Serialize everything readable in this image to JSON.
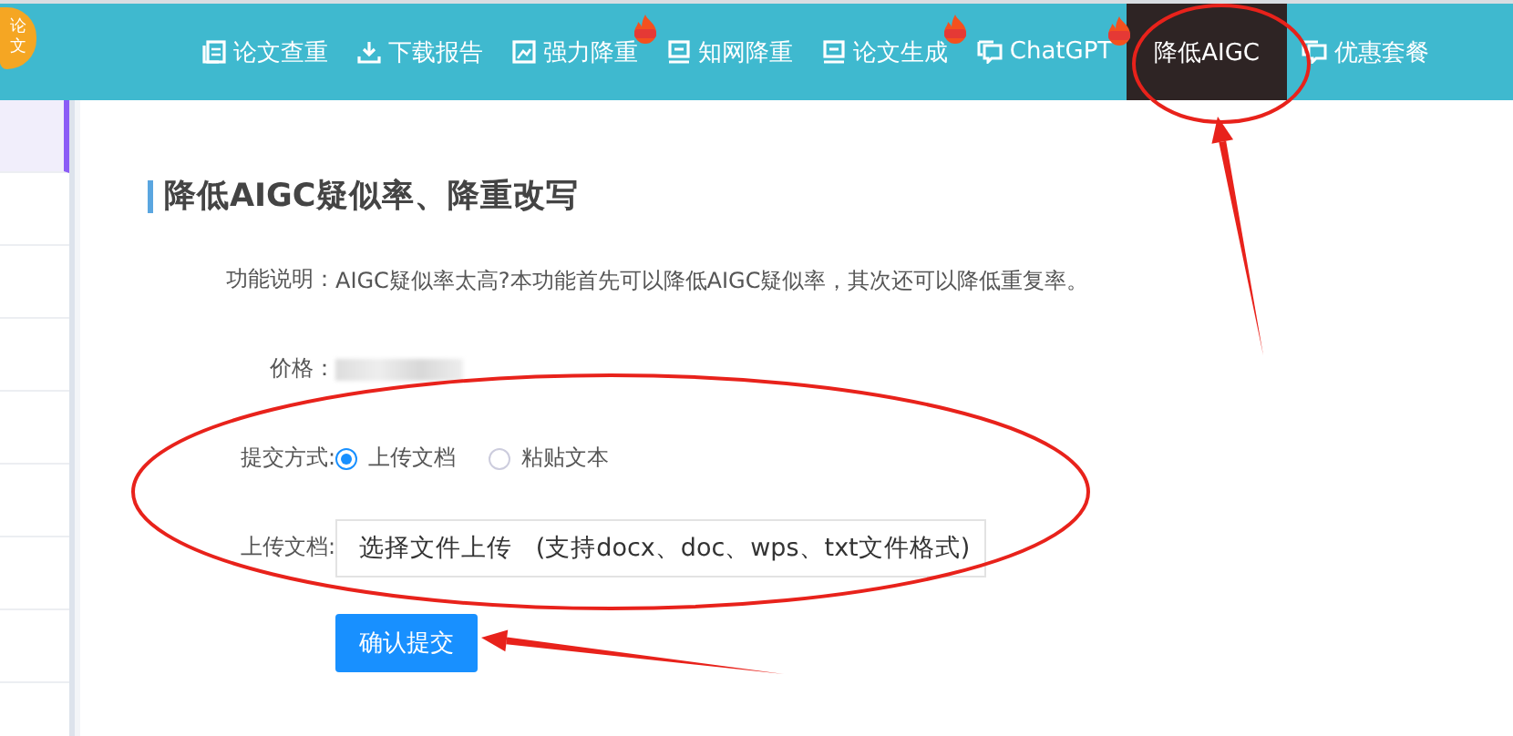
{
  "logo": {
    "text": "论文"
  },
  "nav": {
    "items": [
      {
        "label": "论文查重",
        "hot": false,
        "selected": false
      },
      {
        "label": "下载报告",
        "hot": false,
        "selected": false
      },
      {
        "label": "强力降重",
        "hot": true,
        "selected": false
      },
      {
        "label": "知网降重",
        "hot": false,
        "selected": false
      },
      {
        "label": "论文生成",
        "hot": true,
        "selected": false
      },
      {
        "label": "ChatGPT",
        "hot": true,
        "selected": false
      },
      {
        "label": "降低AIGC",
        "hot": false,
        "selected": true
      },
      {
        "label": "优惠套餐",
        "hot": false,
        "selected": false
      }
    ]
  },
  "sidebar": {
    "items": [
      {
        "selected": true
      },
      {
        "selected": false
      },
      {
        "selected": false
      },
      {
        "selected": false
      },
      {
        "selected": false
      },
      {
        "selected": false
      },
      {
        "selected": false
      },
      {
        "selected": false
      }
    ]
  },
  "page": {
    "title": "降低AIGC疑似率、降重改写",
    "description_label": "功能说明：",
    "description": "AIGC疑似率太高?本功能首先可以降低AIGC疑似率，其次还可以降低重复率。",
    "price_label": "价格：",
    "submit_label": "提交方式:",
    "options": [
      {
        "label": "上传文档",
        "selected": true
      },
      {
        "label": "粘贴文本",
        "selected": false
      }
    ],
    "upload_label": "上传文档:",
    "upload_button": "选择文件上传",
    "upload_hint": "(支持docx、doc、wps、txt文件格式)",
    "submit": "确认提交"
  },
  "annotations": [
    {
      "kind": "ellipse"
    },
    {
      "kind": "arrow"
    },
    {
      "kind": "ellipse"
    },
    {
      "kind": "arrow"
    }
  ]
}
